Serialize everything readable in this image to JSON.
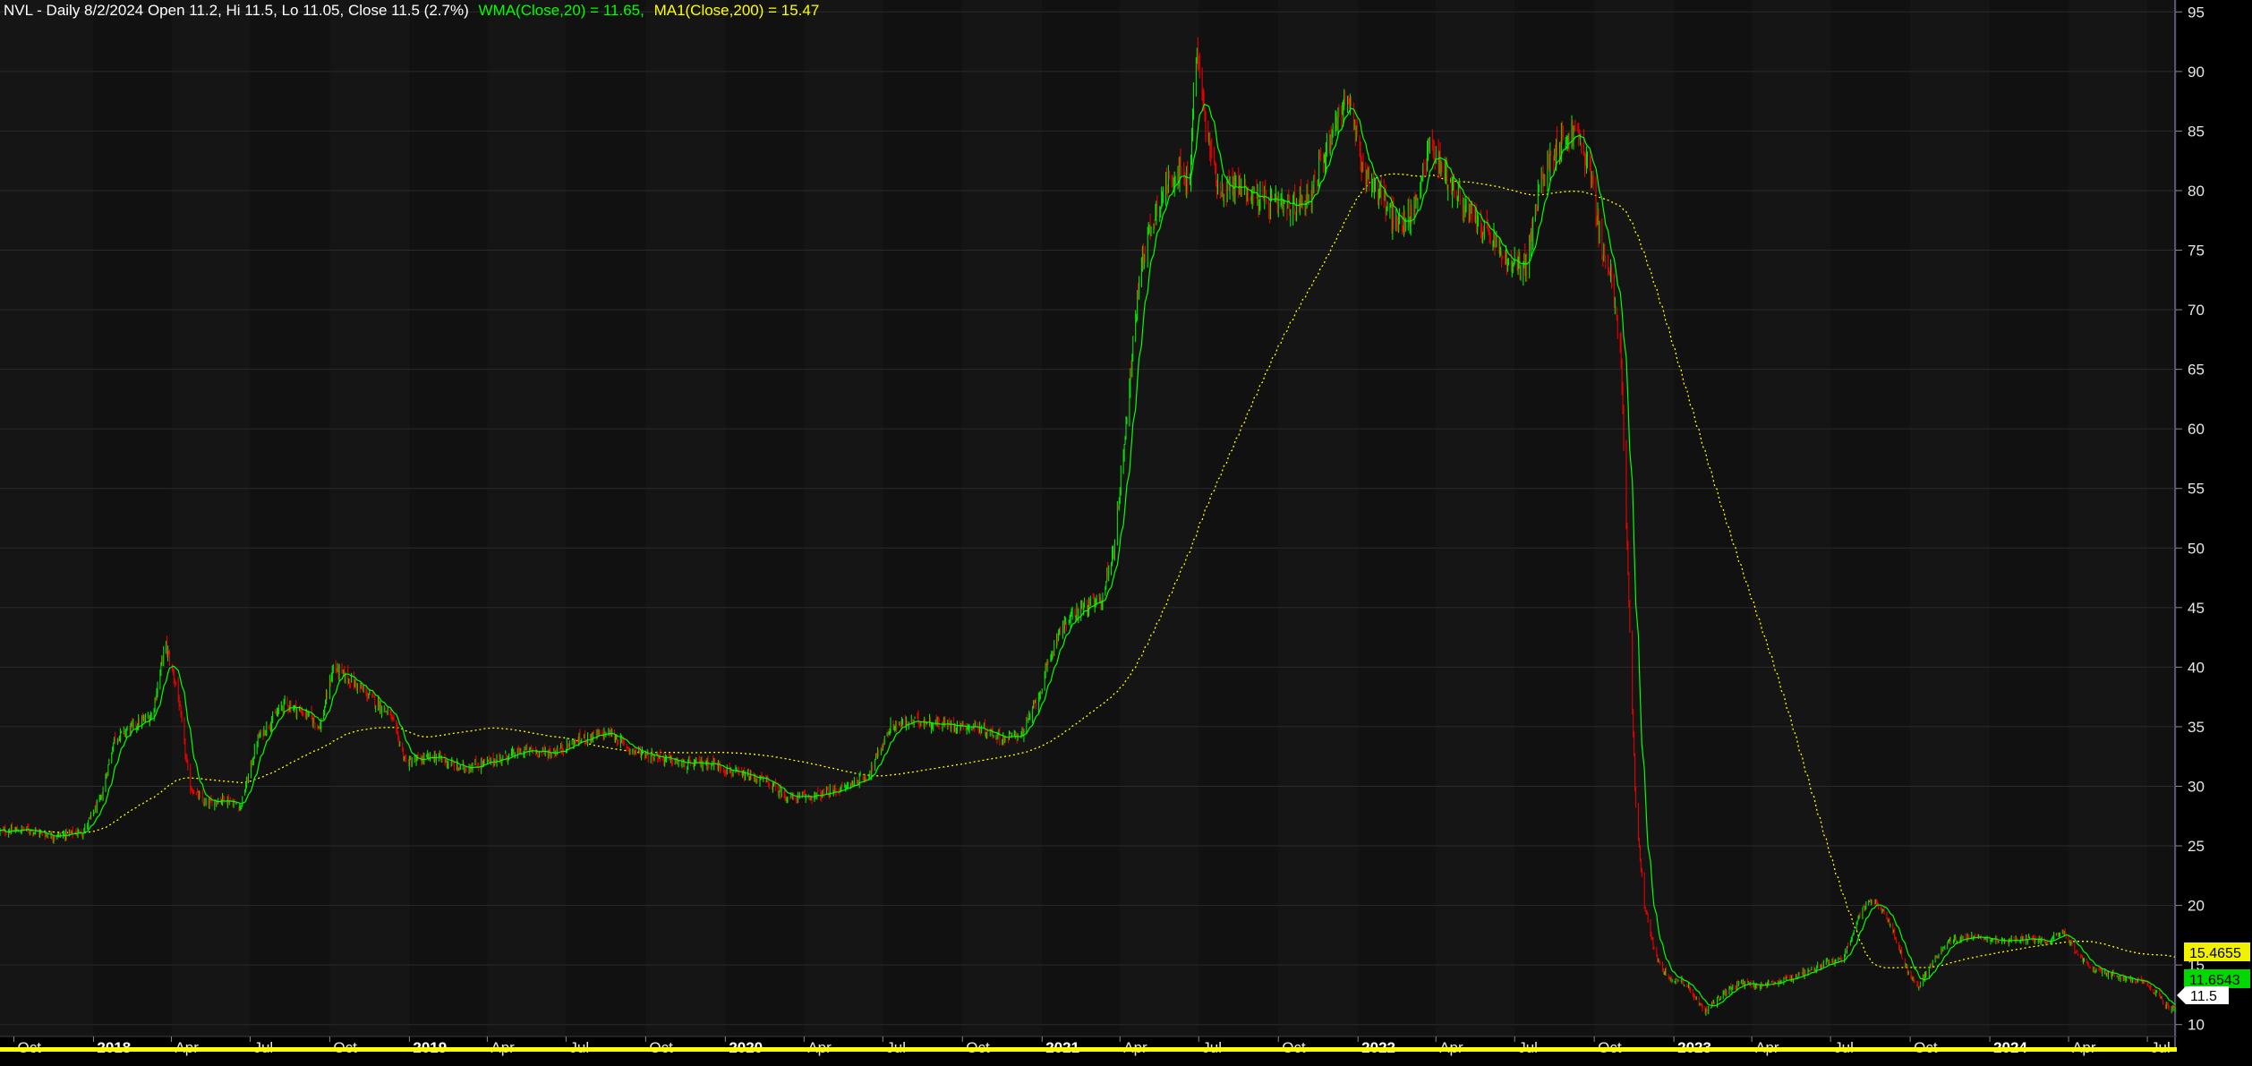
{
  "header": {
    "prefix": "NVL - Daily 8/2/2024 Open 11.2, Hi 11.5, Lo 11.05, Close 11.5 (2.7%)",
    "wma": "WMA(Close,20) = 11.65,",
    "ma": "MA1(Close,200) = 15.47"
  },
  "colors": {
    "background": "#000000",
    "plot_background": "#151515",
    "band_background": "#111111",
    "up_candle": "#00e600",
    "down_candle": "#e60000",
    "wma_line": "#00ff00",
    "ma_line": "#ffff00",
    "grid": "#2a2a2a",
    "axis_text": "#e6e6e6"
  },
  "badges": {
    "ma": "15.4655",
    "wma": "11.6543",
    "close": "11.5"
  },
  "chart_data": {
    "type": "candlestick",
    "symbol": "NVL",
    "date_range": [
      "2017-09-15",
      "2024-08-02"
    ],
    "ylim": [
      9,
      96
    ],
    "y_ticks": [
      10,
      15,
      20,
      25,
      30,
      35,
      40,
      45,
      50,
      55,
      60,
      65,
      70,
      75,
      80,
      85,
      90,
      95
    ],
    "x_ticks": [
      {
        "date": "2017-10-01",
        "label": "Oct",
        "year": false
      },
      {
        "date": "2018-01-01",
        "label": "2018",
        "year": true
      },
      {
        "date": "2018-04-01",
        "label": "Apr",
        "year": false
      },
      {
        "date": "2018-07-01",
        "label": "Jul",
        "year": false
      },
      {
        "date": "2018-10-01",
        "label": "Oct",
        "year": false
      },
      {
        "date": "2019-01-01",
        "label": "2019",
        "year": true
      },
      {
        "date": "2019-04-01",
        "label": "Apr",
        "year": false
      },
      {
        "date": "2019-07-01",
        "label": "Jul",
        "year": false
      },
      {
        "date": "2019-10-01",
        "label": "Oct",
        "year": false
      },
      {
        "date": "2020-01-01",
        "label": "2020",
        "year": true
      },
      {
        "date": "2020-04-01",
        "label": "Apr",
        "year": false
      },
      {
        "date": "2020-07-01",
        "label": "Jul",
        "year": false
      },
      {
        "date": "2020-10-01",
        "label": "Oct",
        "year": false
      },
      {
        "date": "2021-01-01",
        "label": "2021",
        "year": true
      },
      {
        "date": "2021-04-01",
        "label": "Apr",
        "year": false
      },
      {
        "date": "2021-07-01",
        "label": "Jul",
        "year": false
      },
      {
        "date": "2021-10-01",
        "label": "Oct",
        "year": false
      },
      {
        "date": "2022-01-01",
        "label": "2022",
        "year": true
      },
      {
        "date": "2022-04-01",
        "label": "Apr",
        "year": false
      },
      {
        "date": "2022-07-01",
        "label": "Jul",
        "year": false
      },
      {
        "date": "2022-10-01",
        "label": "Oct",
        "year": false
      },
      {
        "date": "2023-01-01",
        "label": "2023",
        "year": true
      },
      {
        "date": "2023-04-01",
        "label": "Apr",
        "year": false
      },
      {
        "date": "2023-07-01",
        "label": "Jul",
        "year": false
      },
      {
        "date": "2023-10-01",
        "label": "Oct",
        "year": false
      },
      {
        "date": "2024-01-01",
        "label": "2024",
        "year": true
      },
      {
        "date": "2024-04-01",
        "label": "Apr",
        "year": false
      },
      {
        "date": "2024-07-01",
        "label": "Jul",
        "year": false
      }
    ],
    "price_path": [
      [
        "2017-09-15",
        26.2
      ],
      [
        "2017-10-15",
        26.4
      ],
      [
        "2017-11-15",
        25.8
      ],
      [
        "2017-12-20",
        26.2
      ],
      [
        "2018-01-10",
        29
      ],
      [
        "2018-01-25",
        34
      ],
      [
        "2018-02-15",
        35
      ],
      [
        "2018-03-10",
        36
      ],
      [
        "2018-03-25",
        42
      ],
      [
        "2018-04-08",
        38
      ],
      [
        "2018-04-22",
        30
      ],
      [
        "2018-05-10",
        28.5
      ],
      [
        "2018-06-01",
        29
      ],
      [
        "2018-06-20",
        28.3
      ],
      [
        "2018-07-10",
        34
      ],
      [
        "2018-08-10",
        37
      ],
      [
        "2018-09-05",
        36
      ],
      [
        "2018-09-20",
        35
      ],
      [
        "2018-10-05",
        40
      ],
      [
        "2018-11-01",
        38.5
      ],
      [
        "2018-12-10",
        36
      ],
      [
        "2018-12-28",
        32
      ],
      [
        "2019-02-01",
        32.5
      ],
      [
        "2019-03-01",
        31.5
      ],
      [
        "2019-04-01",
        32
      ],
      [
        "2019-05-15",
        33
      ],
      [
        "2019-06-15",
        32.8
      ],
      [
        "2019-07-20",
        34
      ],
      [
        "2019-08-20",
        34.5
      ],
      [
        "2019-09-15",
        33
      ],
      [
        "2019-10-15",
        32.5
      ],
      [
        "2019-11-15",
        31.8
      ],
      [
        "2019-12-15",
        32
      ],
      [
        "2020-01-15",
        31
      ],
      [
        "2020-02-15",
        30.5
      ],
      [
        "2020-03-15",
        29
      ],
      [
        "2020-04-15",
        29.2
      ],
      [
        "2020-05-15",
        29.8
      ],
      [
        "2020-06-15",
        31
      ],
      [
        "2020-07-10",
        35
      ],
      [
        "2020-08-10",
        35.5
      ],
      [
        "2020-09-10",
        35.2
      ],
      [
        "2020-10-15",
        35
      ],
      [
        "2020-11-20",
        34
      ],
      [
        "2020-12-10",
        34.5
      ],
      [
        "2020-12-30",
        38
      ],
      [
        "2021-01-20",
        43
      ],
      [
        "2021-02-15",
        45
      ],
      [
        "2021-03-10",
        45.5
      ],
      [
        "2021-03-25",
        50
      ],
      [
        "2021-04-10",
        62
      ],
      [
        "2021-04-25",
        74
      ],
      [
        "2021-05-15",
        79
      ],
      [
        "2021-06-05",
        82
      ],
      [
        "2021-06-20",
        80
      ],
      [
        "2021-06-28",
        92
      ],
      [
        "2021-07-10",
        85
      ],
      [
        "2021-07-25",
        80
      ],
      [
        "2021-08-15",
        80.5
      ],
      [
        "2021-09-15",
        79
      ],
      [
        "2021-10-15",
        78.5
      ],
      [
        "2021-11-10",
        80
      ],
      [
        "2021-12-01",
        85
      ],
      [
        "2021-12-20",
        88
      ],
      [
        "2022-01-05",
        82
      ],
      [
        "2022-01-25",
        80
      ],
      [
        "2022-02-15",
        77
      ],
      [
        "2022-03-05",
        78
      ],
      [
        "2022-03-25",
        84
      ],
      [
        "2022-04-15",
        81
      ],
      [
        "2022-05-10",
        78
      ],
      [
        "2022-06-05",
        76
      ],
      [
        "2022-06-25",
        73.5
      ],
      [
        "2022-07-15",
        74
      ],
      [
        "2022-08-01",
        81
      ],
      [
        "2022-08-20",
        84
      ],
      [
        "2022-09-10",
        85
      ],
      [
        "2022-09-25",
        82
      ],
      [
        "2022-10-08",
        76
      ],
      [
        "2022-10-22",
        72
      ],
      [
        "2022-11-01",
        66
      ],
      [
        "2022-11-10",
        45
      ],
      [
        "2022-11-18",
        28
      ],
      [
        "2022-11-28",
        20
      ],
      [
        "2022-12-10",
        16
      ],
      [
        "2022-12-25",
        14
      ],
      [
        "2023-01-15",
        13.5
      ],
      [
        "2023-02-05",
        11
      ],
      [
        "2023-02-25",
        12.5
      ],
      [
        "2023-03-20",
        13.5
      ],
      [
        "2023-04-15",
        13.2
      ],
      [
        "2023-05-20",
        14
      ],
      [
        "2023-06-20",
        15
      ],
      [
        "2023-07-15",
        15.5
      ],
      [
        "2023-08-05",
        19.5
      ],
      [
        "2023-08-20",
        20.5
      ],
      [
        "2023-09-05",
        19
      ],
      [
        "2023-09-25",
        15
      ],
      [
        "2023-10-10",
        13
      ],
      [
        "2023-10-25",
        15
      ],
      [
        "2023-11-15",
        17
      ],
      [
        "2023-12-15",
        17.5
      ],
      [
        "2024-01-15",
        17
      ],
      [
        "2024-02-15",
        17.2
      ],
      [
        "2024-03-10",
        17
      ],
      [
        "2024-03-25",
        18
      ],
      [
        "2024-04-10",
        16
      ],
      [
        "2024-05-01",
        14.5
      ],
      [
        "2024-06-01",
        14
      ],
      [
        "2024-06-25",
        13.5
      ],
      [
        "2024-07-15",
        12.5
      ],
      [
        "2024-07-25",
        11.3
      ],
      [
        "2024-08-02",
        11.5
      ]
    ],
    "series": [
      {
        "name": "WMA(Close,20)",
        "last": 11.65
      },
      {
        "name": "MA1(Close,200)",
        "last": 15.47
      }
    ]
  }
}
